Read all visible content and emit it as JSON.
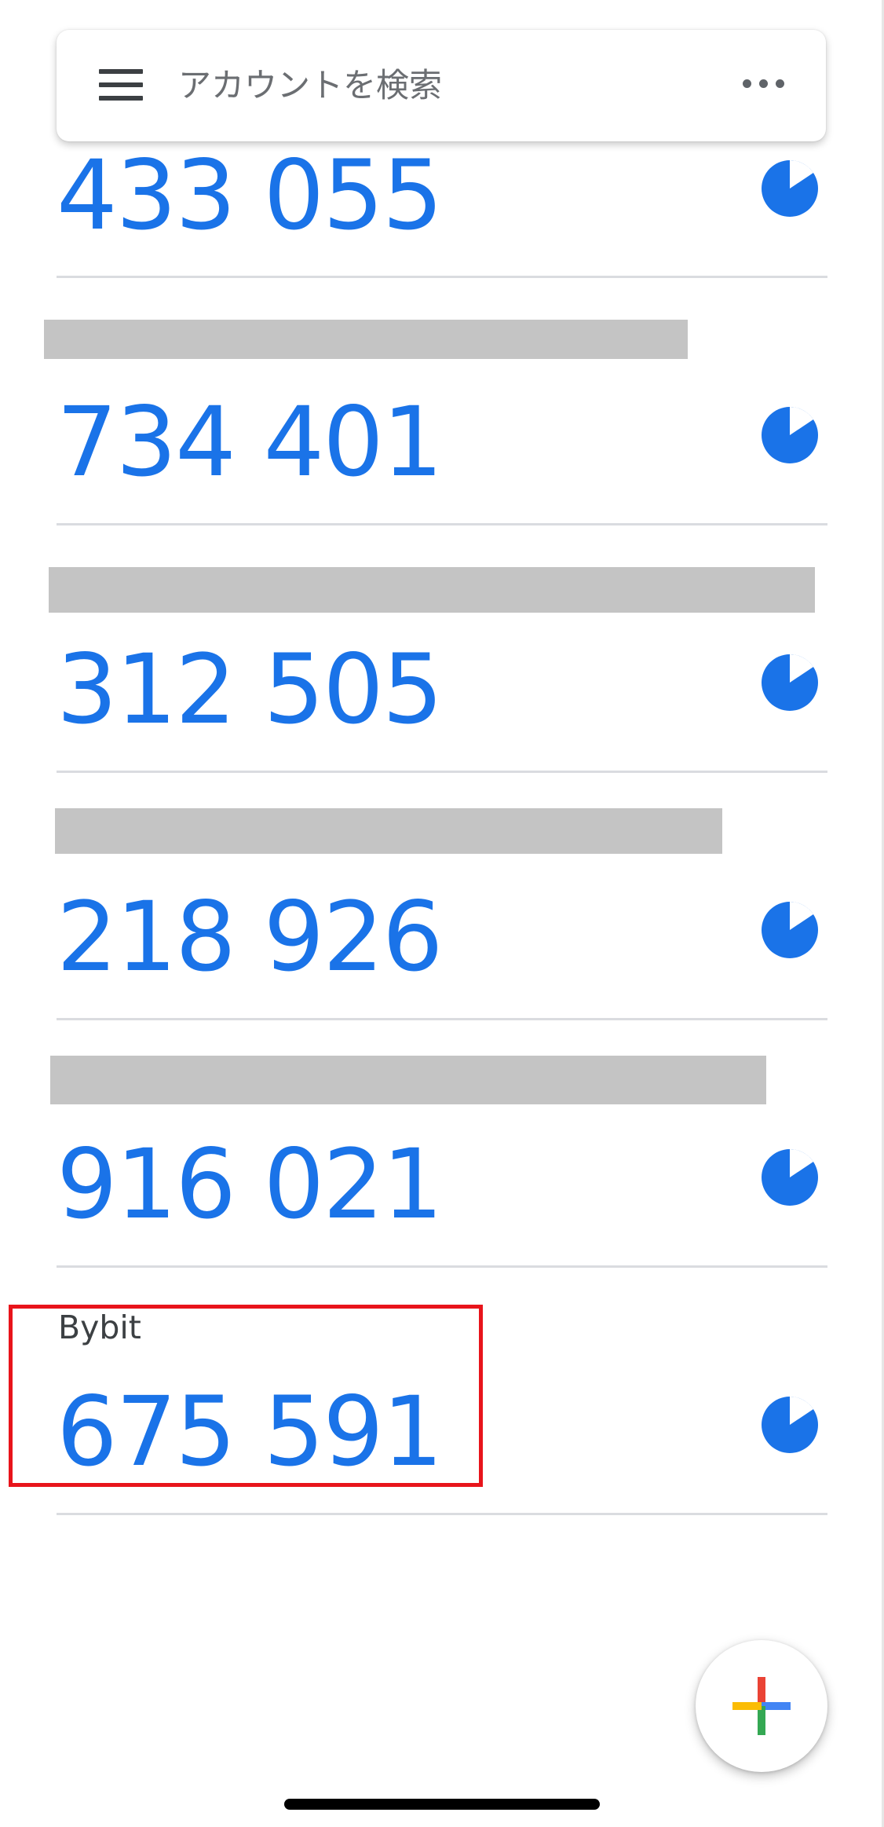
{
  "search": {
    "placeholder": "アカウントを検索"
  },
  "accounts": [
    {
      "name": "",
      "code": "433 055"
    },
    {
      "name": "",
      "code": "734 401"
    },
    {
      "name": "",
      "code": "312 505"
    },
    {
      "name": "",
      "code": "218 926"
    },
    {
      "name": "",
      "code": "916 021"
    },
    {
      "name": "Bybit",
      "code": "675 591"
    }
  ],
  "icons": {
    "menu": "menu-icon",
    "more": "more-horizontal-icon",
    "timer": "countdown-timer-icon",
    "add": "add-plus-icon"
  },
  "colors": {
    "code": "#1a73e8",
    "highlight": "#e8141b",
    "redaction": "#c4c4c4",
    "plus_blue": "#4285f4",
    "plus_red": "#ea4335",
    "plus_yellow": "#fbbc04",
    "plus_green": "#34a853"
  }
}
